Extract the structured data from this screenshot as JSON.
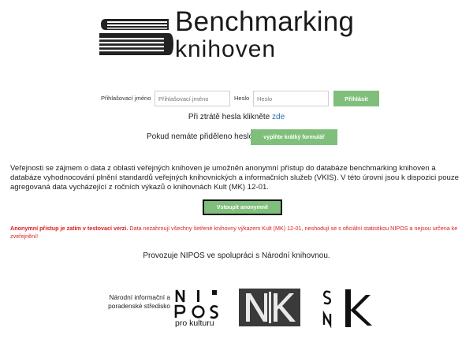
{
  "brand": {
    "title": "Benchmarking",
    "subtitle": "knihoven",
    "logo_icon": "books-stack-icon"
  },
  "login": {
    "username_label": "Přihlašovací jméno",
    "username_placeholder": "Přihlašovací jméno",
    "password_label": "Heslo",
    "password_placeholder": "Heslo",
    "submit_label": "Přihlásit",
    "forgot_text": "Při ztrátě hesla klikněte",
    "forgot_link": "zde"
  },
  "registration": {
    "text": "Pokud nemáte přiděleno heslo",
    "button_label": "vyplňte krátký formulář"
  },
  "info": {
    "text": "Veřejnosti se zájmem o data z oblasti veřejných knihoven je umožněn anonymní přístup do databáze benchmarking knihoven a databáze vyhodnocování plnění standardů veřejných knihovnických a informačních služeb (VKIS). V této úrovni jsou k dispozici pouze agregovaná data vycházející z ročních výkazů o knihovnách Kult (MK) 12-01.",
    "anonymous_button": "Vstoupit anonymně"
  },
  "warning": {
    "bold": "Anonymní přístup je zatím v testovací verzi.",
    "text": "Data nezahrnují všechny šetřené knihovny výkazem Kult (MK) 12-01, neshodují se s oficiální statistikou NIPOS a nejsou určena ke zveřejnění!"
  },
  "footer": {
    "operator": "Provozuje NIPOS ve spolupráci s Národní knihovnou.",
    "nipos_caption": "Národní informační a poradenské středisko",
    "nipos_logo_lines": [
      "N",
      "I",
      "P",
      "O",
      "S"
    ],
    "nipos_tagline": "pro kulturu",
    "nk_letters": "NK",
    "snk_letters": [
      "S",
      "N",
      "K"
    ]
  },
  "colors": {
    "accent_green": "#7fbf7b",
    "link_blue": "#2a6ebb",
    "warning_red": "#d91e1e"
  }
}
